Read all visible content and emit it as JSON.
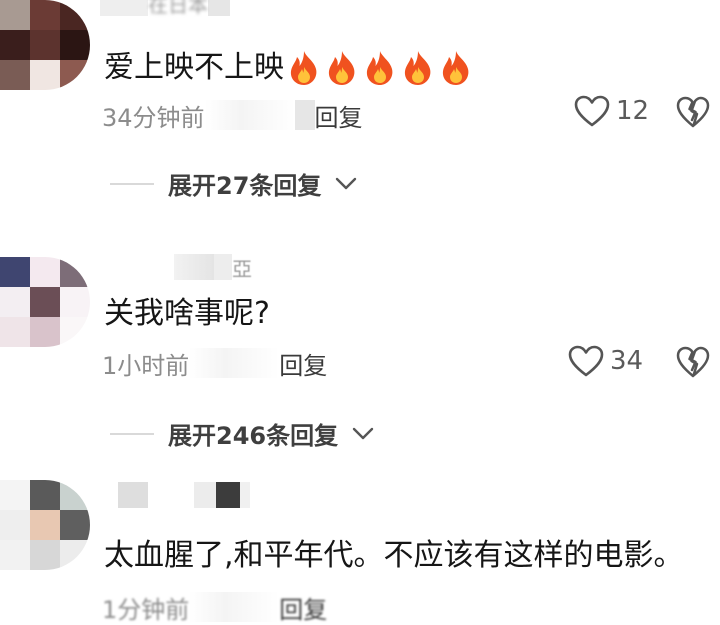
{
  "comments": [
    {
      "username": "在日本",
      "text": "爱上映不上映",
      "flame_count": 5,
      "time": "34分钟前",
      "reply_label": "回复",
      "likes": "12",
      "expand_label": "展开27条回复"
    },
    {
      "username": "亞",
      "text": "关我啥事呢?",
      "time": "1小时前",
      "reply_label": "回复",
      "likes": "34",
      "expand_label": "展开246条回复"
    },
    {
      "username": "",
      "text": "太血腥了,和平年代。不应该有这样的电影。",
      "time": "1分钟前",
      "reply_label": "回复"
    }
  ],
  "icons": {
    "like": "heart-outline-icon",
    "dislike": "broken-heart-icon",
    "expand": "chevron-down-icon",
    "flame": "fire-emoji-icon"
  },
  "colors": {
    "text_primary": "#161616",
    "text_secondary": "#8c8c8c",
    "flame": "#f0521f"
  }
}
